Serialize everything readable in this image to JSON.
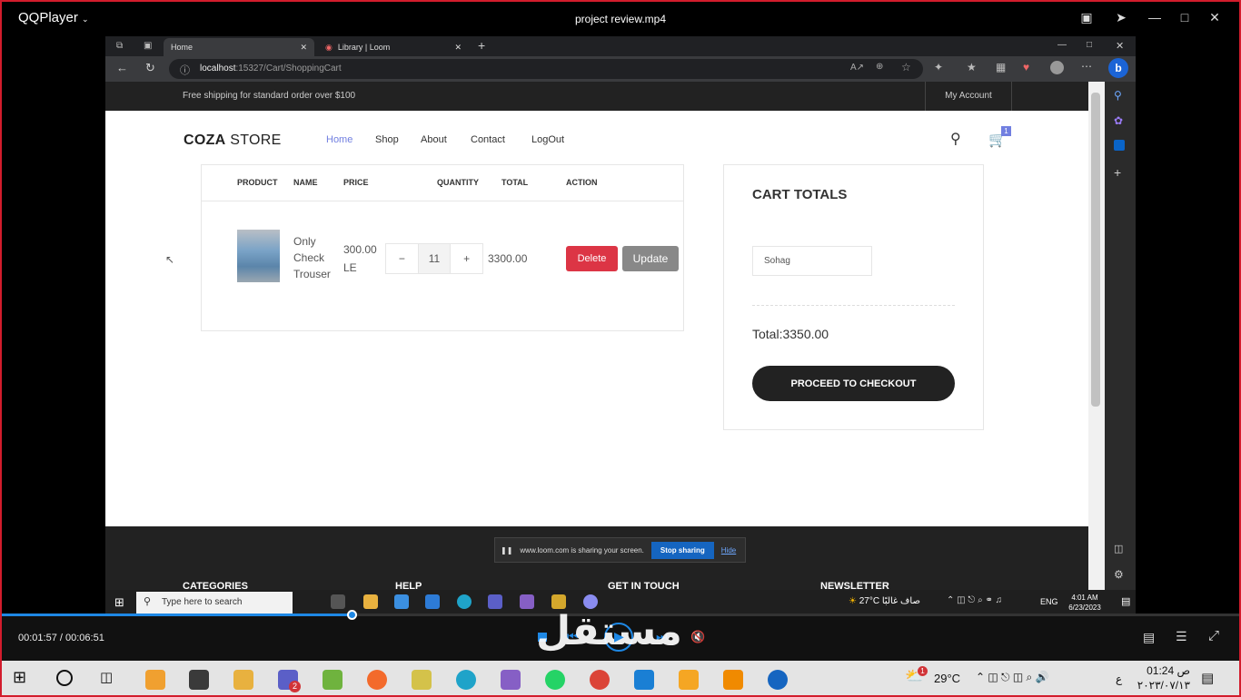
{
  "player": {
    "app_name": "QQPlayer",
    "file_name": "project review.mp4",
    "time": "00:01:57 / 00:06:51",
    "progress": 0.284,
    "watermark": "مستقل"
  },
  "browser": {
    "tabs": [
      {
        "label": "Home",
        "active": true
      },
      {
        "label": "Library | Loom",
        "active": false
      }
    ],
    "url_host": "localhost",
    "url_path": ":15327/Cart/ShoppingCart"
  },
  "site": {
    "top_notice": "Free shipping for standard order over $100",
    "account_link": "My Account",
    "logo_bold": "COZA",
    "logo_rest": " STORE",
    "nav": [
      "Home",
      "Shop",
      "About",
      "Contact",
      "LogOut"
    ],
    "cart_count": "1"
  },
  "cart_table": {
    "headers": [
      "PRODUCT",
      "NAME",
      "PRICE",
      "QUANTITY",
      "TOTAL",
      "ACTION"
    ],
    "row": {
      "name": "Only Check Trouser",
      "price": "300.00 LE",
      "qty_minus": "−",
      "qty": "11",
      "qty_plus": "+",
      "total": "3300.00",
      "delete_label": "Delete",
      "update_label": "Update"
    }
  },
  "cart_totals": {
    "heading": "CART TOTALS",
    "city_value": "Sohag",
    "total_text": "Total:3350.00",
    "checkout_label": "PROCEED TO CHECKOUT"
  },
  "footer": {
    "headings": [
      "CATEGORIES",
      "HELP",
      "GET IN TOUCH",
      "NEWSLETTER"
    ]
  },
  "screen_share": {
    "message": "www.loom.com is sharing your screen.",
    "stop_label": "Stop sharing",
    "hide_label": "Hide"
  },
  "inner_taskbar": {
    "search_placeholder": "Type here to search",
    "weather": "27°C",
    "weather_text": "صاف غالبًا",
    "lang": "ENG",
    "time": "4:01 AM",
    "date": "6/23/2023"
  },
  "os_taskbar": {
    "temperature": "29°C",
    "lang": "ع",
    "time": "01:24 ص",
    "date": "٢٠٢٣/٠٧/١٣",
    "teams_badge": "2",
    "weather_badge": "1"
  },
  "colors": {
    "accent": "#717fe0",
    "delete": "#dc3545",
    "update": "#888888",
    "player_progress": "#1e88e5",
    "frame": "#d21c2c"
  }
}
